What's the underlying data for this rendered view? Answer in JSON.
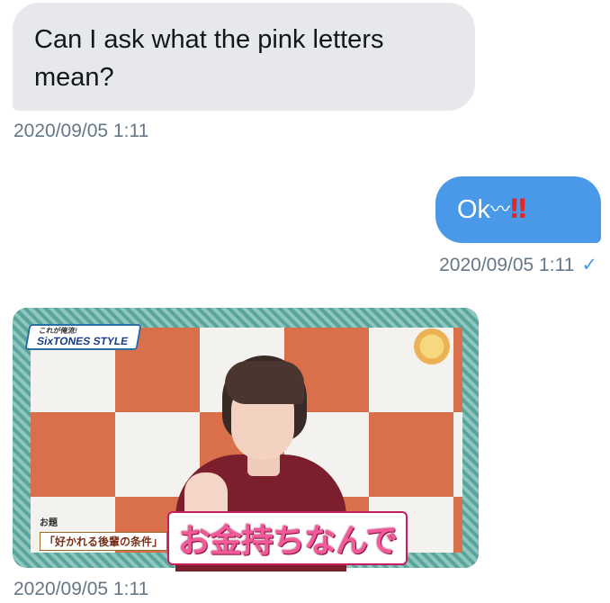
{
  "conversation": {
    "message_in": {
      "text": "Can I ask what the pink letters mean?",
      "timestamp": "2020/09/05 1:11"
    },
    "message_out": {
      "text": "Ok",
      "wave": "〰",
      "emphasis": "‼",
      "timestamp": "2020/09/05 1:11",
      "status_icon": "✓"
    },
    "image_message": {
      "show_label_pre": "これが俺流!",
      "show_label": "SixTONES STYLE",
      "caption_topic_label": "お題",
      "caption_topic": "「好かれる後輩の条件」",
      "caption_main": "お金持ちなんで",
      "timestamp": "2020/09/05 1:11"
    }
  },
  "colors": {
    "incoming_bubble": "#e6e8eb",
    "outgoing_bubble": "#4a99e9",
    "timestamp_text": "#657786",
    "pink_caption": "#f25a9a"
  }
}
